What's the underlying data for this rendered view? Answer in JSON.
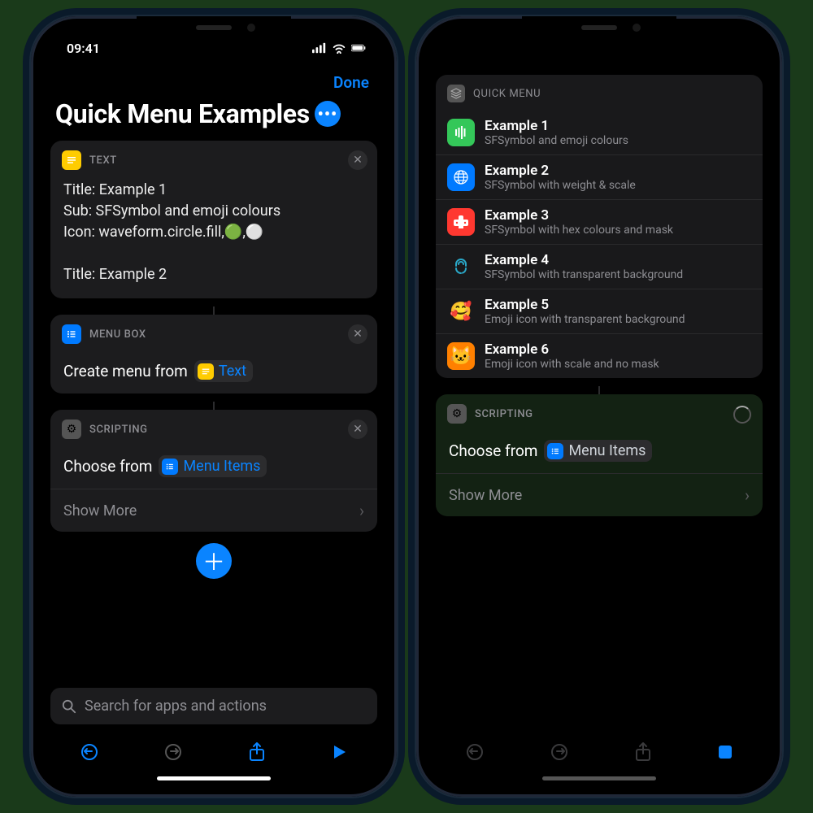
{
  "statusbar": {
    "time": "09:41"
  },
  "nav": {
    "done": "Done"
  },
  "title": "Quick Menu Examples",
  "cards": {
    "text": {
      "header": "TEXT",
      "body": "Title: Example 1\nSub: SFSymbol and emoji colours\nIcon: waveform.circle.fill,🟢,⚪️\n\nTitle: Example 2"
    },
    "menubox": {
      "header": "MENU BOX",
      "action_prefix": "Create menu from",
      "pill": "Text"
    },
    "scripting": {
      "header": "SCRIPTING",
      "action_prefix": "Choose from",
      "pill": "Menu Items",
      "showmore": "Show More"
    }
  },
  "search": {
    "placeholder": "Search for apps and actions"
  },
  "quickmenu": {
    "header": "QUICK MENU",
    "items": [
      {
        "title": "Example 1",
        "sub": "SFSymbol and emoji colours",
        "icon": "🟢",
        "bg": "#34c759"
      },
      {
        "title": "Example 2",
        "sub": "SFSymbol with weight & scale",
        "icon": "🌐",
        "bg": "#007aff"
      },
      {
        "title": "Example 3",
        "sub": "SFSymbol with hex colours and mask",
        "icon": "🎮",
        "bg": "#ff3830"
      },
      {
        "title": "Example 4",
        "sub": "SFSymbol with transparent background",
        "icon": "🌀",
        "bg": "transparent"
      },
      {
        "title": "Example 5",
        "sub": "Emoji icon with transparent background",
        "icon": "🥰",
        "bg": "transparent"
      },
      {
        "title": "Example 6",
        "sub": "Emoji icon with scale and no mask",
        "icon": "🐱",
        "bg": "#ff8000"
      }
    ]
  },
  "scripting2": {
    "header": "SCRIPTING",
    "action_prefix": "Choose from",
    "pill": "Menu Items",
    "showmore": "Show More"
  }
}
